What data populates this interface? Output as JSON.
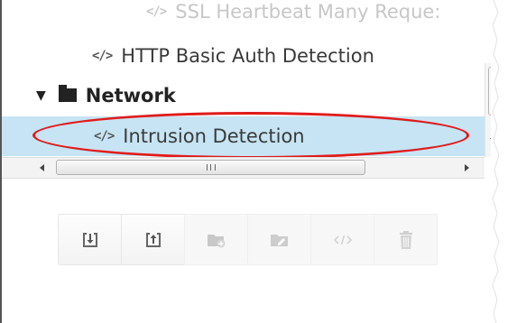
{
  "tree": {
    "items": [
      {
        "label": "SSL Heartbeat Many Reque:",
        "icon": "code-icon",
        "state": "faded"
      },
      {
        "label": "HTTP Basic Auth Detection",
        "icon": "code-icon"
      },
      {
        "label": "Network",
        "icon": "folder-icon",
        "expanded": true
      },
      {
        "label": "Intrusion Detection",
        "icon": "code-icon",
        "selected": true
      }
    ],
    "code_glyph": "</>"
  },
  "toolbar": {
    "buttons": [
      {
        "name": "import-button",
        "icon": "import-icon",
        "enabled": true
      },
      {
        "name": "export-button",
        "icon": "export-icon",
        "enabled": true
      },
      {
        "name": "add-folder-button",
        "icon": "add-folder-icon",
        "enabled": false
      },
      {
        "name": "edit-folder-button",
        "icon": "edit-folder-icon",
        "enabled": false
      },
      {
        "name": "code-button",
        "icon": "code-icon",
        "enabled": false
      },
      {
        "name": "delete-button",
        "icon": "trash-icon",
        "enabled": false
      }
    ]
  },
  "colors": {
    "selection": "#c6e4f3",
    "annotation": "#e01b1b"
  }
}
